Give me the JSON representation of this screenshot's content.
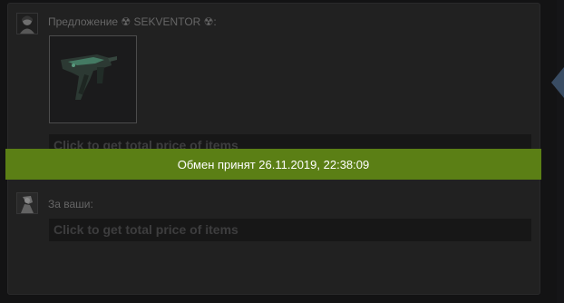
{
  "offer": {
    "heading": "Предложение ☢ SEKVENTOR ☢:",
    "item_icon": "mp9-submachine-gun",
    "price_hint": "Click to get total price of items"
  },
  "banner": {
    "text": "Обмен принят 26.11.2019, 22:38:09"
  },
  "request": {
    "heading": "За ваши:",
    "price_hint": "Click to get total price of items"
  },
  "colors": {
    "banner_bg": "#5b7f15",
    "panel_bg": "#2e2e2f",
    "arrow": "#4f6a8a"
  }
}
